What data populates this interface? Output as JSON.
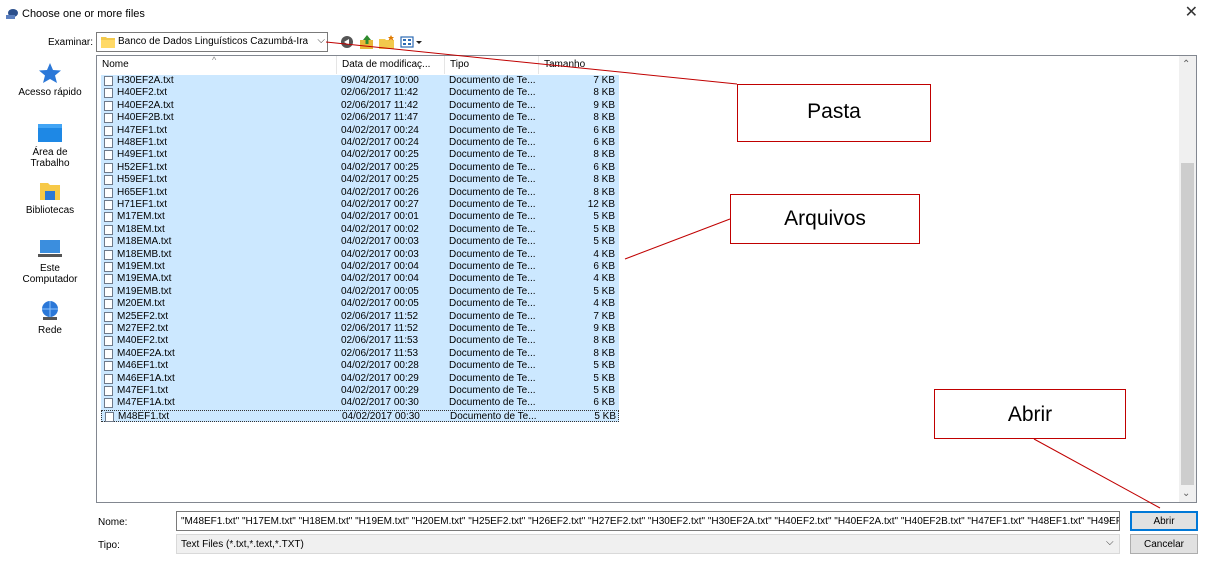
{
  "window": {
    "title": "Choose one or more files"
  },
  "lookin": {
    "label": "Examinar:",
    "value": "Banco de Dados Linguísticos Cazumbá-Iracema"
  },
  "places": [
    {
      "label": "Acesso rápido",
      "icon": "star-icon"
    },
    {
      "label": "Área de Trabalho",
      "icon": "desktop-icon"
    },
    {
      "label": "Bibliotecas",
      "icon": "libraries-icon"
    },
    {
      "label": "Este Computador",
      "icon": "computer-icon"
    },
    {
      "label": "Rede",
      "icon": "network-icon"
    }
  ],
  "columns": {
    "name": "Nome",
    "date": "Data de modificaç...",
    "type": "Tipo",
    "size": "Tamanho"
  },
  "files": [
    {
      "name": "H30EF2A.txt",
      "date": "09/04/2017 10:00",
      "type": "Documento de Te...",
      "size": "7 KB"
    },
    {
      "name": "H40EF2.txt",
      "date": "02/06/2017 11:42",
      "type": "Documento de Te...",
      "size": "8 KB"
    },
    {
      "name": "H40EF2A.txt",
      "date": "02/06/2017 11:42",
      "type": "Documento de Te...",
      "size": "9 KB"
    },
    {
      "name": "H40EF2B.txt",
      "date": "02/06/2017 11:47",
      "type": "Documento de Te...",
      "size": "8 KB"
    },
    {
      "name": "H47EF1.txt",
      "date": "04/02/2017 00:24",
      "type": "Documento de Te...",
      "size": "6 KB"
    },
    {
      "name": "H48EF1.txt",
      "date": "04/02/2017 00:24",
      "type": "Documento de Te...",
      "size": "6 KB"
    },
    {
      "name": "H49EF1.txt",
      "date": "04/02/2017 00:25",
      "type": "Documento de Te...",
      "size": "8 KB"
    },
    {
      "name": "H52EF1.txt",
      "date": "04/02/2017 00:25",
      "type": "Documento de Te...",
      "size": "6 KB"
    },
    {
      "name": "H59EF1.txt",
      "date": "04/02/2017 00:25",
      "type": "Documento de Te...",
      "size": "8 KB"
    },
    {
      "name": "H65EF1.txt",
      "date": "04/02/2017 00:26",
      "type": "Documento de Te...",
      "size": "8 KB"
    },
    {
      "name": "H71EF1.txt",
      "date": "04/02/2017 00:27",
      "type": "Documento de Te...",
      "size": "12 KB"
    },
    {
      "name": "M17EM.txt",
      "date": "04/02/2017 00:01",
      "type": "Documento de Te...",
      "size": "5 KB"
    },
    {
      "name": "M18EM.txt",
      "date": "04/02/2017 00:02",
      "type": "Documento de Te...",
      "size": "5 KB"
    },
    {
      "name": "M18EMA.txt",
      "date": "04/02/2017 00:03",
      "type": "Documento de Te...",
      "size": "5 KB"
    },
    {
      "name": "M18EMB.txt",
      "date": "04/02/2017 00:03",
      "type": "Documento de Te...",
      "size": "4 KB"
    },
    {
      "name": "M19EM.txt",
      "date": "04/02/2017 00:04",
      "type": "Documento de Te...",
      "size": "6 KB"
    },
    {
      "name": "M19EMA.txt",
      "date": "04/02/2017 00:04",
      "type": "Documento de Te...",
      "size": "4 KB"
    },
    {
      "name": "M19EMB.txt",
      "date": "04/02/2017 00:05",
      "type": "Documento de Te...",
      "size": "5 KB"
    },
    {
      "name": "M20EM.txt",
      "date": "04/02/2017 00:05",
      "type": "Documento de Te...",
      "size": "4 KB"
    },
    {
      "name": "M25EF2.txt",
      "date": "02/06/2017 11:52",
      "type": "Documento de Te...",
      "size": "7 KB"
    },
    {
      "name": "M27EF2.txt",
      "date": "02/06/2017 11:52",
      "type": "Documento de Te...",
      "size": "9 KB"
    },
    {
      "name": "M40EF2.txt",
      "date": "02/06/2017 11:53",
      "type": "Documento de Te...",
      "size": "8 KB"
    },
    {
      "name": "M40EF2A.txt",
      "date": "02/06/2017 11:53",
      "type": "Documento de Te...",
      "size": "8 KB"
    },
    {
      "name": "M46EF1.txt",
      "date": "04/02/2017 00:28",
      "type": "Documento de Te...",
      "size": "5 KB"
    },
    {
      "name": "M46EF1A.txt",
      "date": "04/02/2017 00:29",
      "type": "Documento de Te...",
      "size": "5 KB"
    },
    {
      "name": "M47EF1.txt",
      "date": "04/02/2017 00:29",
      "type": "Documento de Te...",
      "size": "5 KB"
    },
    {
      "name": "M47EF1A.txt",
      "date": "04/02/2017 00:30",
      "type": "Documento de Te...",
      "size": "6 KB"
    },
    {
      "name": "M48EF1.txt",
      "date": "04/02/2017 00:30",
      "type": "Documento de Te...",
      "size": "5 KB"
    }
  ],
  "filename": {
    "label": "Nome:",
    "value": "\"M48EF1.txt\" \"H17EM.txt\" \"H18EM.txt\" \"H19EM.txt\" \"H20EM.txt\" \"H25EF2.txt\" \"H26EF2.txt\" \"H27EF2.txt\" \"H30EF2.txt\" \"H30EF2A.txt\" \"H40EF2.txt\" \"H40EF2A.txt\" \"H40EF2B.txt\" \"H47EF1.txt\" \"H48EF1.txt\" \"H49EF"
  },
  "filetype": {
    "label": "Tipo:",
    "value": "Text Files (*.txt,*.text,*.TXT)"
  },
  "buttons": {
    "open": "Abrir",
    "cancel": "Cancelar"
  },
  "annotations": {
    "folder": "Pasta",
    "files": "Arquivos",
    "open": "Abrir"
  },
  "colors": {
    "selection": "#cce8ff",
    "accent": "#0078d7",
    "annotation": "#c00000"
  }
}
